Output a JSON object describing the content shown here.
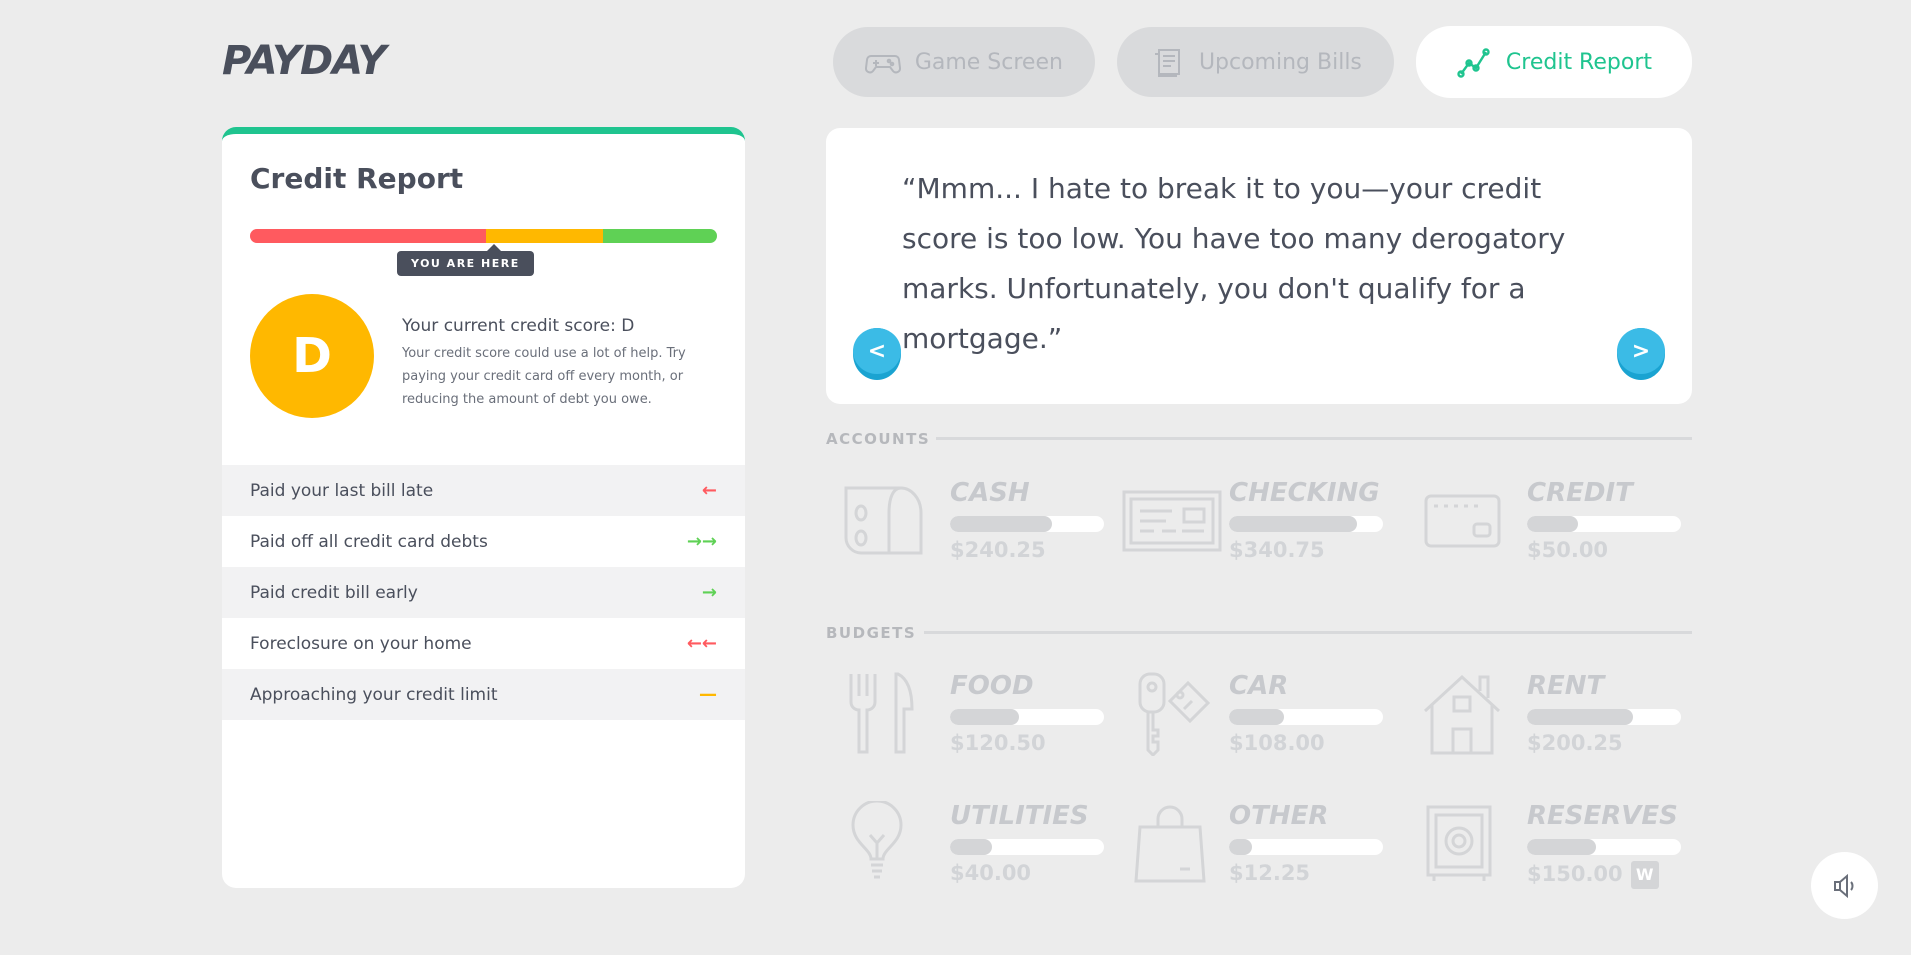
{
  "app": {
    "logo": "PAYDAY"
  },
  "tabs": [
    {
      "label": "Game Screen",
      "icon": "gamepad-icon",
      "active": false
    },
    {
      "label": "Upcoming Bills",
      "icon": "bills-icon",
      "active": false
    },
    {
      "label": "Credit Report",
      "icon": "trend-line-icon",
      "active": true
    }
  ],
  "credit_report": {
    "title": "Credit Report",
    "score_bar": {
      "segments": [
        {
          "color": "#ff5a5f",
          "fraction": 0.505
        },
        {
          "color": "#ffb800",
          "fraction": 0.25
        },
        {
          "color": "#5fd155",
          "fraction": 0.245
        }
      ],
      "indicator_label": "YOU ARE HERE"
    },
    "grade": "D",
    "grade_color": "#ffb800",
    "score_heading": "Your current credit score: D",
    "score_description": "Your credit score could use a lot of help. Try paying your credit card off every month, or reducing the amount of debt you owe.",
    "factors": [
      {
        "label": "Paid your last bill late",
        "indicator": "←",
        "color": "#ff5a5f"
      },
      {
        "label": "Paid off all credit card debts",
        "indicator": "→→",
        "color": "#5fd155"
      },
      {
        "label": "Paid credit bill early",
        "indicator": "→",
        "color": "#5fd155"
      },
      {
        "label": "Foreclosure on your home",
        "indicator": "←←",
        "color": "#ff5a5f"
      },
      {
        "label": "Approaching your credit limit",
        "indicator": "—",
        "color": "#ffb800"
      }
    ]
  },
  "dialog": {
    "text": "“Mmm... I hate to break it to you—your credit score is too low. You have too many derogatory marks. Unfortunately, you don't qualify for a mortgage.”",
    "prev_label": "<",
    "next_label": ">"
  },
  "accounts": {
    "label": "ACCOUNTS",
    "items": [
      {
        "name": "CASH",
        "amount": "$240.25",
        "fill": 0.66,
        "icon": "cash-icon"
      },
      {
        "name": "CHECKING",
        "amount": "$340.75",
        "fill": 0.83,
        "icon": "check-icon"
      },
      {
        "name": "CREDIT",
        "amount": "$50.00",
        "fill": 0.33,
        "icon": "credit-card-icon"
      }
    ]
  },
  "budgets": {
    "label": "BUDGETS",
    "items": [
      {
        "name": "FOOD",
        "amount": "$120.50",
        "fill": 0.45,
        "icon": "fork-knife-icon"
      },
      {
        "name": "CAR",
        "amount": "$108.00",
        "fill": 0.36,
        "icon": "car-key-icon"
      },
      {
        "name": "RENT",
        "amount": "$200.25",
        "fill": 0.69,
        "icon": "house-icon"
      },
      {
        "name": "UTILITIES",
        "amount": "$40.00",
        "fill": 0.27,
        "icon": "lightbulb-icon"
      },
      {
        "name": "OTHER",
        "amount": "$12.25",
        "fill": 0.15,
        "icon": "shopping-bag-icon"
      },
      {
        "name": "RESERVES",
        "amount": "$150.00",
        "fill": 0.45,
        "icon": "safe-icon",
        "badge": "W"
      }
    ]
  },
  "sound": {
    "icon": "speaker-icon"
  }
}
